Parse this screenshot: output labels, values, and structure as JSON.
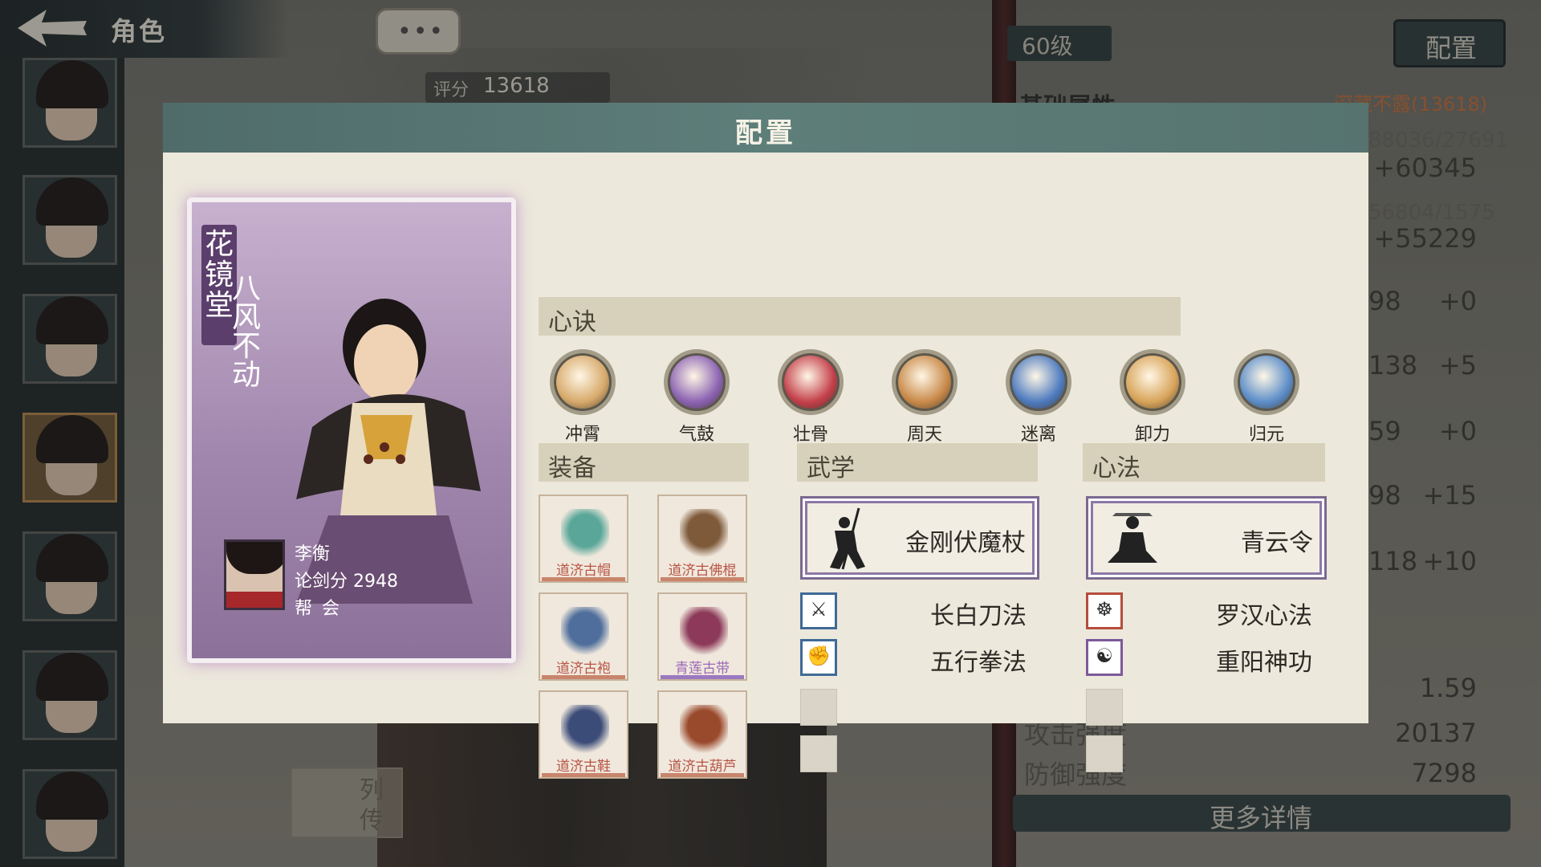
{
  "header": {
    "title": "角色"
  },
  "chat": {
    "dots": "•••"
  },
  "rating": {
    "label": "评分",
    "value": "13618"
  },
  "right_panel": {
    "level": "60级",
    "config_button": "配置",
    "section_title": "基础属性",
    "hidden_rating": "深藏不露(13618)",
    "rows": [
      {
        "left": "88036/27691",
        "right": "+60345"
      },
      {
        "left": "56804/1575",
        "right": "+55229"
      },
      {
        "left": "98",
        "right": "+0"
      },
      {
        "left": "138",
        "right": "+5"
      },
      {
        "left": "59",
        "right": "+0"
      },
      {
        "left": "98",
        "right": "+15"
      },
      {
        "left": "118",
        "right": "+10"
      }
    ],
    "crit_value": "1.59",
    "attack_label": "攻击强度",
    "attack_value": "20137",
    "defense_label": "防御强度",
    "defense_value": "7298",
    "more_details": "更多详情"
  },
  "biography": {
    "label": "列传"
  },
  "modal": {
    "title": "配置",
    "character": {
      "faction": "花镜堂",
      "skill_title": "八风不动",
      "name": "李衡",
      "score": "论剑分 2948",
      "guild": "帮会"
    },
    "mind_section": "心诀",
    "mind_skills": [
      {
        "label": "冲霄",
        "color": "#d7a96b"
      },
      {
        "label": "气鼓",
        "color": "#8c63b2"
      },
      {
        "label": "壮骨",
        "color": "#c4404b"
      },
      {
        "label": "周天",
        "color": "#c98a4a"
      },
      {
        "label": "迷离",
        "color": "#4f7cc0"
      },
      {
        "label": "卸力",
        "color": "#d8a45a"
      },
      {
        "label": "归元",
        "color": "#5d8ec9"
      }
    ],
    "equip_section": "装备",
    "equipment": [
      {
        "name": "道济古帽",
        "quality": "red",
        "color": "#5aa79a"
      },
      {
        "name": "道济古佛棍",
        "quality": "red",
        "color": "#7e5a3a"
      },
      {
        "name": "道济古袍",
        "quality": "red",
        "color": "#4f6e9c"
      },
      {
        "name": "青莲古带",
        "quality": "purple",
        "color": "#8d3a5a"
      },
      {
        "name": "道济古鞋",
        "quality": "red",
        "color": "#3b4c78"
      },
      {
        "name": "道济古葫芦",
        "quality": "red",
        "color": "#9a4a2c"
      }
    ],
    "martial_section": "武学",
    "martial_main": "金刚伏魔杖",
    "martial_subs": [
      "长白刀法",
      "五行拳法"
    ],
    "heart_section": "心法",
    "heart_main": "青云令",
    "heart_subs": [
      "罗汉心法",
      "重阳神功"
    ],
    "colors": {
      "header": "#56736f",
      "body": "#ece8dc",
      "accent_purple": "#7b6990"
    }
  }
}
